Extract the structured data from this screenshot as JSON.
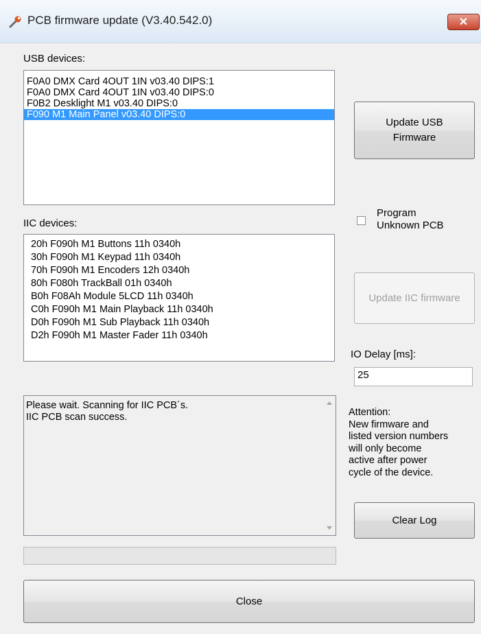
{
  "window": {
    "title": "PCB firmware update (V3.40.542.0)",
    "close_glyph": "✕",
    "icon": "wrench-icon"
  },
  "usb": {
    "label": "USB devices:",
    "items": [
      "F0A0  DMX Card 4OUT 1IN  v03.40  DIPS:1",
      "F0A0  DMX Card 4OUT 1IN  v03.40  DIPS:0",
      "F0B2  Desklight M1  v03.40  DIPS:0",
      "F090  M1 Main Panel  v03.40  DIPS:0"
    ],
    "selected_index": 3,
    "update_button_line1": "Update USB",
    "update_button_line2": "Firmware"
  },
  "program_unknown": {
    "line1": "Program",
    "line2": "Unknown PCB",
    "checked": false
  },
  "iic": {
    "label": "IIC devices:",
    "items": [
      "20h  F090h  M1 Buttons 11h  0340h",
      "30h  F090h  M1 Keypad 11h  0340h",
      "70h  F090h  M1  Encoders 12h  0340h",
      "80h  F080h  TrackBall 01h  0340h",
      "B0h  F08Ah  Module 5LCD 11h  0340h",
      "C0h  F090h  M1 Main Playback 11h  0340h",
      "D0h  F090h  M1 Sub Playback 11h  0340h",
      "D2h  F090h  M1 Master Fader 11h  0340h"
    ],
    "update_button": "Update IIC firmware"
  },
  "io_delay": {
    "label": "IO Delay [ms]:",
    "value": "25"
  },
  "log": {
    "lines": [
      "Please wait. Scanning for IIC PCB´s.",
      "IIC PCB scan success."
    ]
  },
  "attention": {
    "heading": "Attention:",
    "lines": [
      "New firmware and",
      "listed version numbers",
      "will only become",
      "active after power",
      "cycle of the device."
    ]
  },
  "buttons": {
    "clear_log": "Clear Log",
    "close": "Close"
  },
  "progress": {
    "value": 0
  }
}
